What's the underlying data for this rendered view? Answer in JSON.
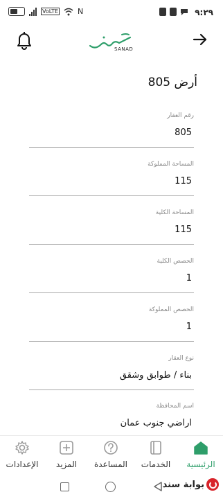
{
  "status_bar": {
    "time": "٩:٢٩",
    "network_label": "VoLTE"
  },
  "header": {
    "logo_arabic": "سند",
    "logo_latin": "SANAD",
    "bell_icon": "bell-icon",
    "back_icon": "arrow-right-icon"
  },
  "page": {
    "title": "أرض 805"
  },
  "fields": [
    {
      "label": "رقم العقار",
      "value": "805"
    },
    {
      "label": "المساحة المملوكة",
      "value": "115"
    },
    {
      "label": "المساحة الكلية",
      "value": "115"
    },
    {
      "label": "الحصص الكلية",
      "value": "1"
    },
    {
      "label": "الحصص المملوكة",
      "value": "1"
    },
    {
      "label": "نوع العقار",
      "value": "بناء / طوابق وشقق"
    },
    {
      "label": "اسم المحافظة",
      "value": "اراضي جنوب عمان"
    }
  ],
  "bottom_nav": {
    "items": [
      {
        "label": "الإعدادات",
        "icon": "gear-icon"
      },
      {
        "label": "المزيد",
        "icon": "plus-square-icon"
      },
      {
        "label": "المساعدة",
        "icon": "help-circle-icon"
      },
      {
        "label": "الخدمات",
        "icon": "services-icon"
      },
      {
        "label": "الرئيسية",
        "icon": "home-icon"
      }
    ],
    "active_color": "#2e9e6a"
  },
  "watermark": {
    "text": "بوابة سند"
  },
  "colors": {
    "brand_green": "#2e9e6a",
    "divider": "#a8a8a8",
    "label_gray": "#8a8a8a"
  }
}
